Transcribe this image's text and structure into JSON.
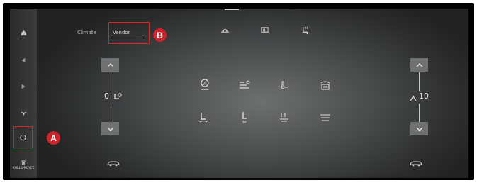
{
  "tabs": {
    "climate": "Climate",
    "vendor": "Vendor"
  },
  "badges": {
    "a": "A",
    "b": "B"
  },
  "left_control": {
    "value": "0"
  },
  "right_control": {
    "value": "10"
  },
  "brand": {
    "logo": "♛",
    "text": "ROLLS-ROYCE"
  },
  "icons": {
    "sidebar": [
      "home-icon",
      "volume-down-icon",
      "volume-up-icon",
      "fan-icon",
      "power-icon"
    ],
    "top": [
      "fan-defrost-icon",
      "rear-defrost-icon",
      "seat-heat-icon"
    ],
    "grid": [
      "auto-a-icon",
      "fan-mode-icon",
      "temp-sync-icon",
      "rear-window-icon",
      "fan-speed-icon",
      "seat-fan-icon",
      "air-flow-icon",
      "recirculate-icon"
    ]
  },
  "colors": {
    "highlight_box": "#dd2222",
    "badge": "#d0222b"
  }
}
